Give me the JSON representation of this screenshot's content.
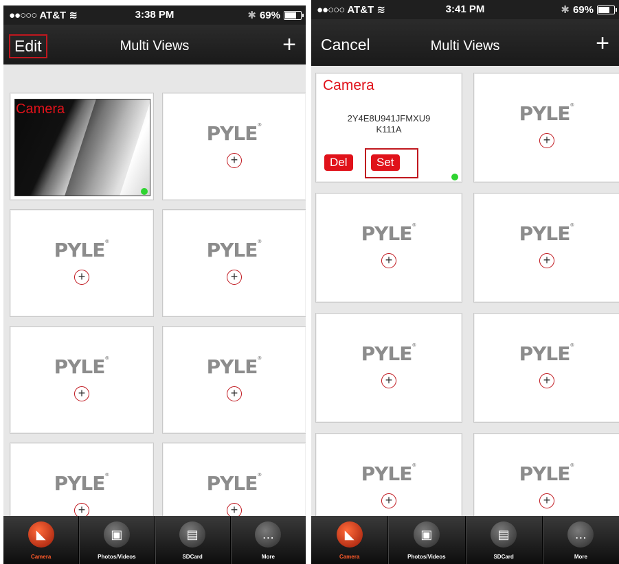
{
  "status_left": {
    "carrier": "AT&T",
    "time": "3:38 PM",
    "battery": "69%"
  },
  "status_right": {
    "carrier": "AT&T",
    "time": "3:41 PM",
    "battery": "69%"
  },
  "nav_left": {
    "edit": "Edit",
    "title": "Multi Views",
    "add": "+"
  },
  "nav_right": {
    "cancel": "Cancel",
    "title": "Multi Views",
    "add": "+"
  },
  "camera_tile": {
    "name": "Camera",
    "device_id_line1": "2Y4E8U941JFMXU9",
    "device_id_line2": "K111A",
    "del": "Del",
    "set": "Set"
  },
  "placeholder": {
    "logo": "PYLE",
    "plus": "+"
  },
  "tabs": [
    {
      "label": "Camera",
      "icon": "camera-icon"
    },
    {
      "label": "Photos/Videos",
      "icon": "film-icon"
    },
    {
      "label": "SDCard",
      "icon": "sdcard-icon"
    },
    {
      "label": "More",
      "icon": "chat-bubble-icon"
    }
  ],
  "colors": {
    "accent": "#e0121a",
    "online": "#2fd431",
    "bar": "#1f1f1f"
  }
}
